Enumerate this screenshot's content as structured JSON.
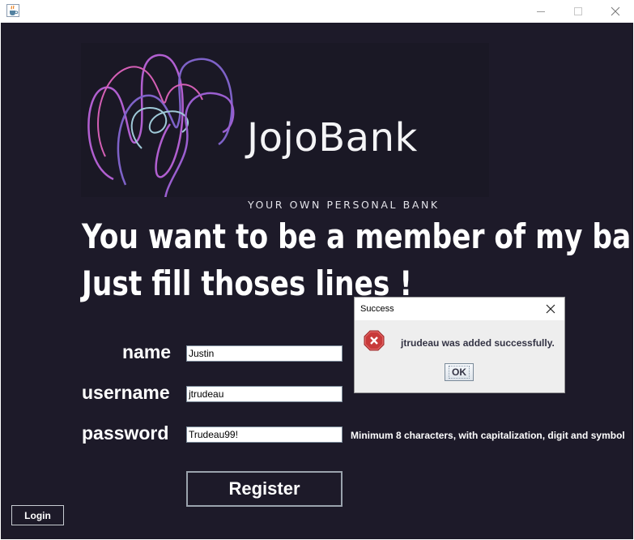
{
  "window": {
    "icon": "java-cup-icon",
    "controls": [
      "minimize-icon",
      "maximize-icon",
      "close-icon"
    ]
  },
  "brand": {
    "name": "JojoBank",
    "tagline": "YOUR OWN PERSONAL BANK",
    "colors": {
      "background": "#1d1a29",
      "logo_purple": "#b15fd0",
      "logo_violet": "#7e62c8",
      "logo_pink": "#d45fb5",
      "logo_light_blue": "#9fc9d8"
    }
  },
  "headline": {
    "line1": "You want to be a member of my bank ?",
    "line2": "Just fill thoses lines !"
  },
  "form": {
    "name_label": "name",
    "name_value": "Justin",
    "username_label": "username",
    "username_value": "jtrudeau",
    "password_label": "password",
    "password_value": "Trudeau99!",
    "password_hint": "Minimum 8 characters,  with capitalization, digit and symbol",
    "register_label": "Register",
    "login_label": "Login"
  },
  "dialog": {
    "title": "Success",
    "icon": "error-icon",
    "message": "jtrudeau was added successfully.",
    "ok_label": "OK"
  }
}
